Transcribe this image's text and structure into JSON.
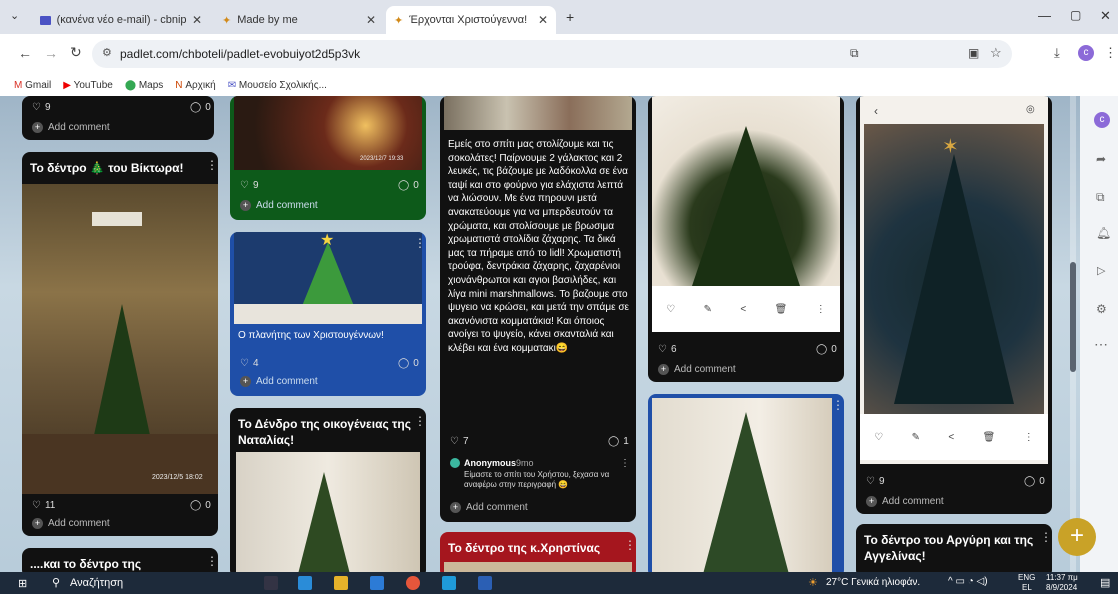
{
  "browser": {
    "tabs": [
      {
        "title": "(κανένα νέο e-mail) - cbnip@y",
        "active": false
      },
      {
        "title": "Made by me",
        "active": false
      },
      {
        "title": "Έρχονται Χριστούγεννα!",
        "active": true
      }
    ],
    "new_tab": "+",
    "url": "padlet.com/chboteli/padlet-evobuiyot2d5p3vk",
    "bookmarks": [
      "Gmail",
      "YouTube",
      "Maps",
      "Αρχική",
      "Μουσείο Σχολικής..."
    ]
  },
  "cards": {
    "c1": {
      "likes": "9",
      "comments": "0",
      "add_comment": "Add comment"
    },
    "c2": {
      "title": "Το δέντρο 🎄 του Βίκτωρα!",
      "photo_date": "2023/12/5 18:02",
      "likes": "11",
      "comments": "0",
      "add_comment": "Add comment"
    },
    "c3": {
      "title": "....και το δέντρο της"
    },
    "c4": {
      "photo_date": "2023/12/7 19:33",
      "likes": "9",
      "comments": "0",
      "add_comment": "Add comment"
    },
    "c5": {
      "caption": "Ο πλανήτης των Χριστουγέννων!",
      "likes": "4",
      "comments": "0",
      "add_comment": "Add comment"
    },
    "c6": {
      "title": "Το Δένδρο της οικογένειας της Ναταλίας!"
    },
    "c7": {
      "body": "Εμείς στο σπίτι μας στολίζουμε και τις σοκολάτες! Παίρνουμε 2 γάλακτος και 2 λευκές, τις βάζουμε με λαδόκολλα σε ένα ταψί και στο φούρνο για ελάχιστα λεπτά να λιώσουν. Με ένα πηρουνι μετά ανακατεύουμε για να μπερδευτούν τα χρώματα, και στολίσουμε με βρωσιμα χρωματιστά στολίδια ζάχαρης. Τα δικά μας τα πήραμε από το lidl! Χρωματιστή τρούφα, δεντράκια ζάχαρης, ζαχαρένιοι χιονάνθρωποι και αγιοι βασιλήδες, και λίγα mini marshmallows. Το βαζουμε στο ψυγειο να κρώσει, και μετά την σπάμε σε ακανόνιστα κομματάκια! Και όποιος ανοίγει το ψυγείο, κάνει σκανταλιά και κλέβει και ένα κομματακι😄",
      "likes": "7",
      "comments": "1",
      "commenter": "Anonymous",
      "comment_time": "9mo",
      "comment_text": "Είμαστε το σπίτι του Χρήστου, ξεχασα να αναφέρω στην περιγραφή 😄",
      "add_comment": "Add comment"
    },
    "c8": {
      "title": "Το δέντρο της κ.Χρηστίνας"
    },
    "c9": {
      "likes": "6",
      "comments": "0",
      "add_comment": "Add comment"
    },
    "c11": {
      "likes": "9",
      "comments": "0",
      "add_comment": "Add comment"
    },
    "c12": {
      "title": "Το δέντρο του Αργύρη και της Αγγελίνας!"
    }
  },
  "fab": "+",
  "taskbar": {
    "search": "Αναζήτηση",
    "weather": "27°C Γενικά ηλιοφάν.",
    "lang": "ENG",
    "lang2": "EL",
    "time": "11:37 πμ",
    "date": "8/9/2024"
  },
  "colors": {
    "accent_green": "#0d7a0d",
    "accent_blue": "#1f4fa8",
    "accent_red": "#a5161e",
    "fab": "#c9a227"
  }
}
